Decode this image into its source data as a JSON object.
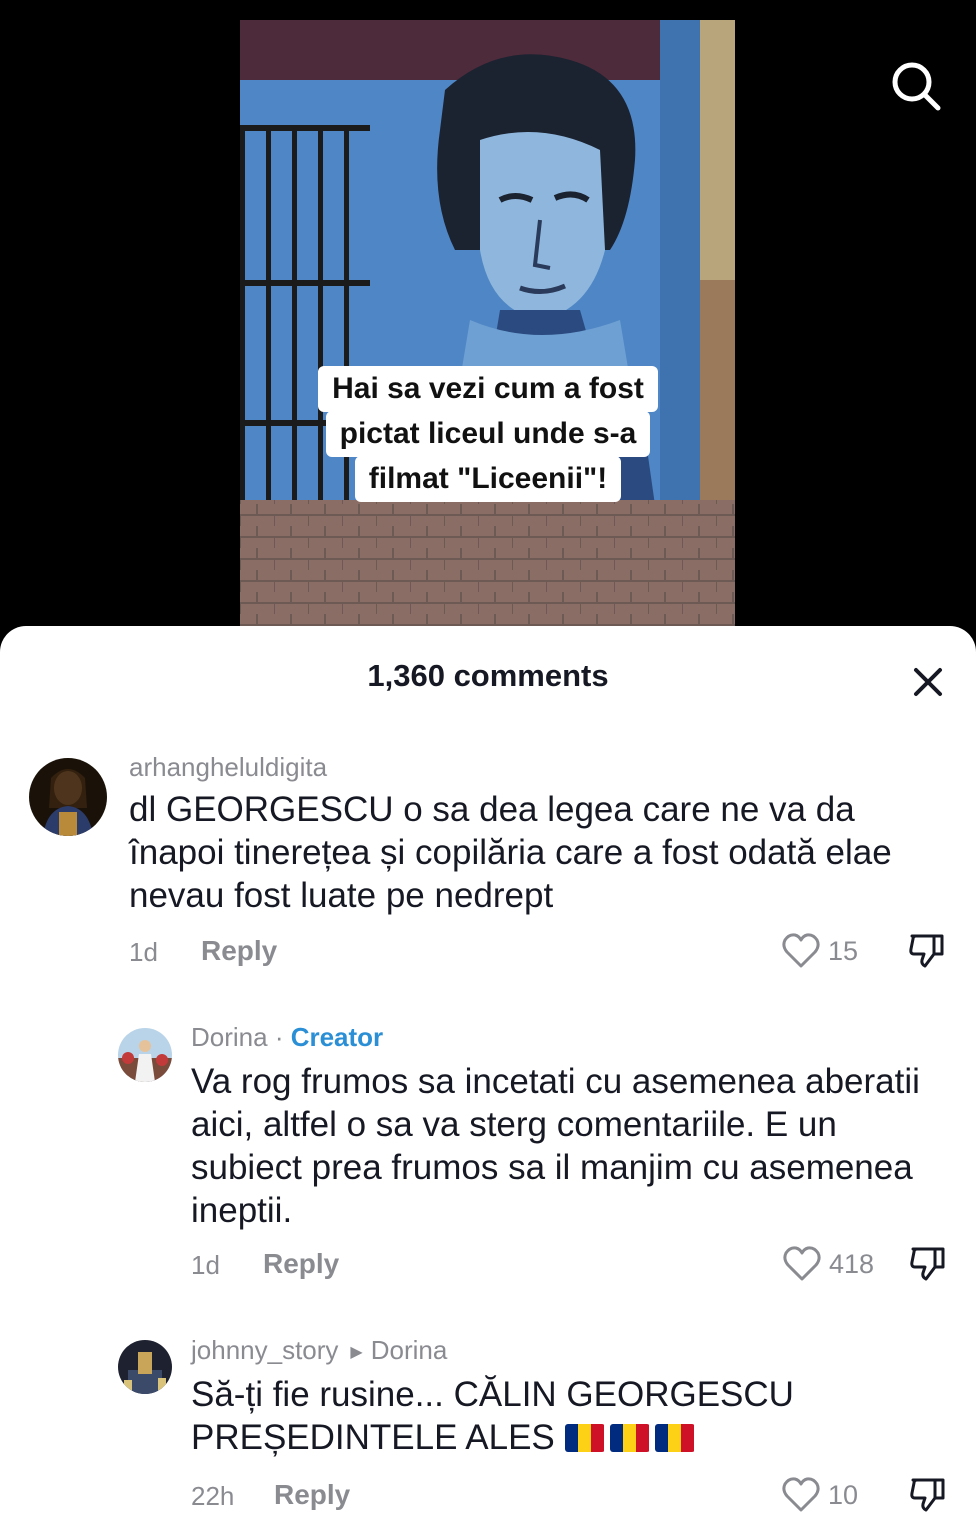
{
  "video": {
    "caption_lines": [
      "Hai sa vezi cum a fost",
      "pictat liceul unde s-a",
      "filmat \"Liceenii\"!"
    ],
    "search_icon": "search-icon"
  },
  "comments_sheet": {
    "title": "1,360 comments",
    "close_icon": "close-icon",
    "comments": [
      {
        "username": "arhangheluldigita",
        "text": "dl GEORGESCU o sa dea legea care ne va da înapoi tinerețea și copilăria care a fost odată elae nevau fost luate pe nedrept",
        "time": "1d",
        "reply_label": "Reply",
        "likes": "15"
      },
      {
        "username": "Dorina",
        "separator": " · ",
        "badge": "Creator",
        "text": "Va rog frumos sa incetati cu asemenea aberatii aici, altfel o sa va sterg comentariile. E un subiect prea frumos sa il manjim cu asemenea ineptii.",
        "time": "1d",
        "reply_label": "Reply",
        "likes": "418"
      },
      {
        "username": "johnny_story",
        "reply_to": "Dorina",
        "text": "Să-ți fie rusine... CĂLIN GEORGESCU PREȘEDINTELE ALES",
        "flags": 3,
        "time": "22h",
        "reply_label": "Reply",
        "likes": "10"
      }
    ]
  },
  "colors": {
    "text_primary": "#161823",
    "text_secondary": "#8a8b91",
    "creator_badge": "#2b8fd6",
    "flag_blue": "#002b7f",
    "flag_yellow": "#fcd116",
    "flag_red": "#ce1126"
  }
}
